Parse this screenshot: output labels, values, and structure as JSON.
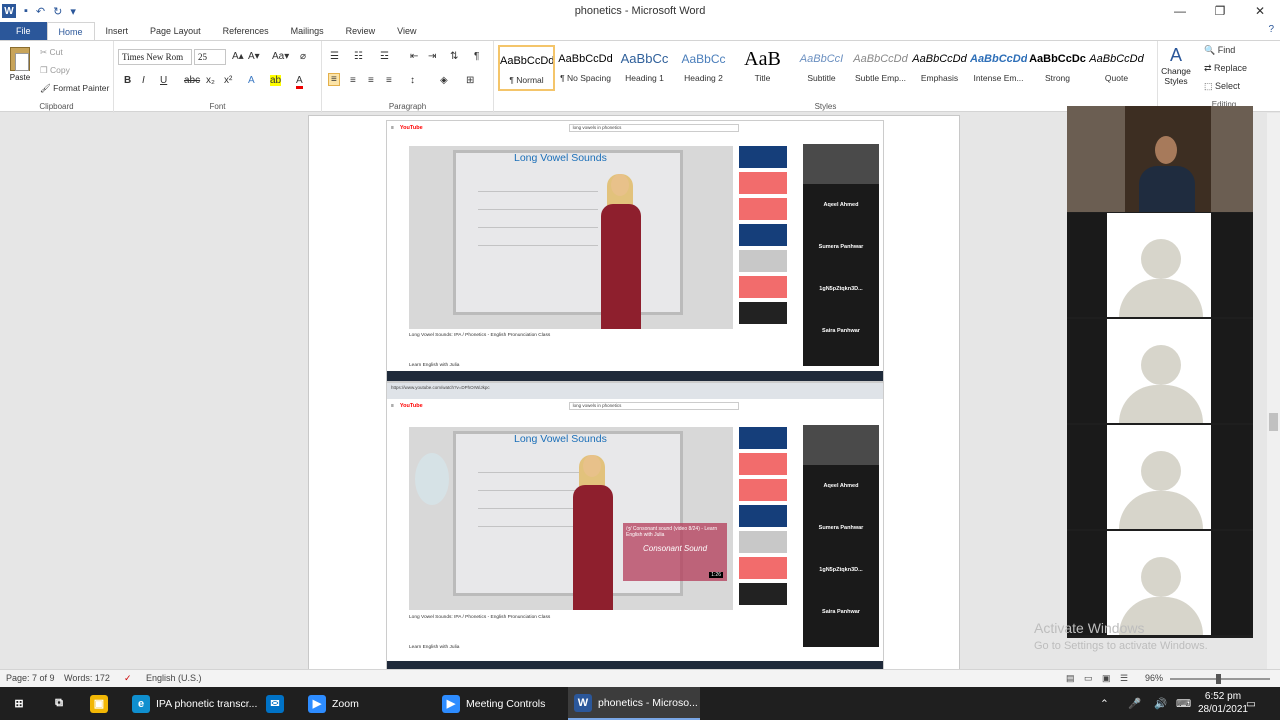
{
  "window": {
    "title": "phonetics - Microsoft Word",
    "app_icon": "W"
  },
  "ribbon_tabs": [
    "File",
    "Home",
    "Insert",
    "Page Layout",
    "References",
    "Mailings",
    "Review",
    "View"
  ],
  "clipboard": {
    "paste": "Paste",
    "cut": "Cut",
    "copy": "Copy",
    "format_painter": "Format Painter",
    "group": "Clipboard"
  },
  "font": {
    "name": "Times New Rom",
    "size": "25",
    "group": "Font"
  },
  "paragraph": {
    "group": "Paragraph"
  },
  "styles": {
    "items": [
      {
        "preview": "AaBbCcDd",
        "name": "¶ Normal"
      },
      {
        "preview": "AaBbCcDd",
        "name": "¶ No Spacing"
      },
      {
        "preview": "AaBbCc",
        "name": "Heading 1"
      },
      {
        "preview": "AaBbCc",
        "name": "Heading 2"
      },
      {
        "preview": "AaB",
        "name": "Title"
      },
      {
        "preview": "AaBbCcI",
        "name": "Subtitle"
      },
      {
        "preview": "AaBbCcDd",
        "name": "Subtle Emp..."
      },
      {
        "preview": "AaBbCcDd",
        "name": "Emphasis"
      },
      {
        "preview": "AaBbCcDd",
        "name": "Intense Em..."
      },
      {
        "preview": "AaBbCcDc",
        "name": "Strong"
      },
      {
        "preview": "AaBbCcDd",
        "name": "Quote"
      }
    ],
    "change_styles": "Change Styles",
    "group": "Styles"
  },
  "editing": {
    "find": "Find",
    "replace": "Replace",
    "select": "Select",
    "group": "Editing"
  },
  "embedded": {
    "yt_logo": "YouTube",
    "search": "long vowels in phonetics",
    "video_title": "Long Vowel Sounds",
    "caption": "Long Vowel Sounds: IPA / Phonetics - English Pronunciation Class",
    "channel": "Learn English with Julia",
    "consonant_card": "/ʒ/ Consonant sound (video 8/24) - Learn English with Julia",
    "consonant_card_sub": "Consonant Sound",
    "duration": "1:26",
    "url": "https://www.youtube.com/watch?v=DPhOrWiJkpc",
    "participants": [
      "Aqeel Ahmed",
      "Sumera Panhwar",
      "1gN5pZtqkn3D...",
      "Saira Panhwar"
    ]
  },
  "status": {
    "page": "Page: 7 of 9",
    "words": "Words: 172",
    "language": "English (U.S.)",
    "zoom": "96%"
  },
  "watermark": {
    "line1": "Activate Windows",
    "line2": "Go to Settings to activate Windows."
  },
  "taskbar": {
    "items": [
      "IPA phonetic transcr...",
      "Zoom",
      "Meeting Controls",
      "phonetics - Microso..."
    ],
    "time": "6:52 pm",
    "date": "28/01/2021"
  }
}
